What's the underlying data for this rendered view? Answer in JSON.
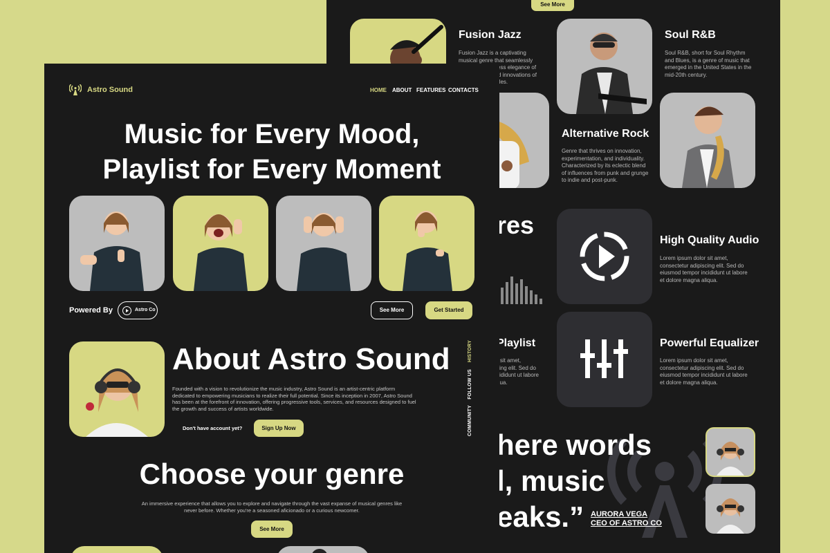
{
  "back": {
    "top_button": "See More",
    "genres": [
      {
        "title": "Fusion Jazz",
        "desc": "Fusion Jazz is a captivating musical genre that seamlessly blends the timeless elegance of jazz with the bold innovations of various other styles."
      },
      {
        "title": "Soul R&B",
        "desc": "Soul R&B, short for Soul Rhythm and Blues, is a genre of music that emerged in the United States in the mid-20th century."
      },
      {
        "title": "Alternative Rock",
        "desc": "Genre that thrives on innovation, experimentation, and individuality. Characterized by its eclectic blend of influences from punk and grunge to indie and post-punk."
      }
    ],
    "features_partial_title": "res",
    "features": [
      {
        "title": "High Quality Audio",
        "desc": "Lorem ipsum dolor sit amet, consectetur adipiscing elit. Sed do eiusmod tempor incididunt ut labore et dolore magna aliqua."
      },
      {
        "title": "Powerful Equalizer",
        "desc": "Lorem ipsum dolor sit amet, consectetur adipiscing elit. Sed do eiusmod tempor incididunt ut labore et dolore magna aliqua."
      }
    ],
    "playlist_partial_title": "Playlist",
    "playlist_partial_desc": "r sit amet,\ncing elit. Sed do\ncididunt ut labore\nqua.",
    "quote_lines": [
      "here words",
      "l, music",
      "eaks.”"
    ],
    "quote_author": "AURORA VEGA",
    "quote_role": "CEO OF ASTRO CO",
    "colors": {
      "accent": "#d7d883",
      "bg": "#1a1a1a",
      "tile": "#2e2e32"
    }
  },
  "front": {
    "brand": "Astro Sound",
    "nav": [
      {
        "label": "HOME",
        "active": true
      },
      {
        "label": "ABOUT",
        "active": false
      },
      {
        "label": "FEATURES",
        "active": false
      },
      {
        "label": "CONTACTS",
        "active": false
      }
    ],
    "hero_line1": "Music for Every Mood,",
    "hero_line2": "Playlist for Every Moment",
    "powered_by": "Powered By",
    "partner": "Astro Co",
    "see_more": "See More",
    "get_started": "Get Started",
    "about_title": "About Astro Sound",
    "about_text": "Founded with a vision to revolutionize the music industry, Astro Sound is an artist-centric platform dedicated to empowering musicians to realize their full potential. Since its inception in 2007, Astro Sound has been at the forefront of innovation, offering progressive tools, services, and resources designed to fuel the growth and success of artists worldwide.",
    "no_account": "Don't have account yet?",
    "sign_up": "Sign Up Now",
    "side_links": [
      "HISTORY",
      "FOLLOW US",
      "COMMUNITY"
    ],
    "genre_title": "Choose your genre",
    "genre_text": "An immersive experience that allows you to explore and navigate through the vast expanse of musical genres like never before. Whether you're a seasoned aficionado or a curious newcomer.",
    "genre_button": "See More"
  }
}
